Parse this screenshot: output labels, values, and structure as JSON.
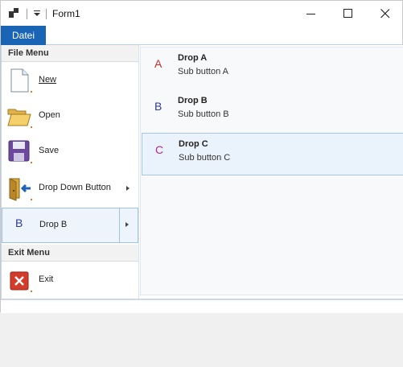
{
  "window": {
    "title": "Form1",
    "controls": {
      "minimize": "minimize-icon",
      "maximize": "maximize-icon",
      "close": "close-icon"
    }
  },
  "menubar": {
    "file_tab": "Datei"
  },
  "left_menu": {
    "file_header": "File Menu",
    "items": [
      {
        "label": "New",
        "icon": "new-document-icon"
      },
      {
        "label": "Open",
        "icon": "open-folder-icon"
      },
      {
        "label": "Save",
        "icon": "floppy-disk-icon"
      },
      {
        "label": "Drop Down Button",
        "icon": "door-arrow-icon",
        "has_submenu": true
      },
      {
        "label": "Drop B",
        "letter": "B",
        "has_submenu": true,
        "selected": true
      }
    ],
    "exit_header": "Exit Menu",
    "exit_item": {
      "label": "Exit",
      "icon": "exit-x-icon"
    }
  },
  "submenu": {
    "items": [
      {
        "letter": "A",
        "title": "Drop A",
        "desc": "Sub button A",
        "color": "#d12a2a"
      },
      {
        "letter": "B",
        "title": "Drop B",
        "desc": "Sub button B",
        "color": "#2b3aa3"
      },
      {
        "letter": "C",
        "title": "Drop C",
        "desc": "Sub button C",
        "color": "#b3298f",
        "hover": true
      }
    ]
  }
}
